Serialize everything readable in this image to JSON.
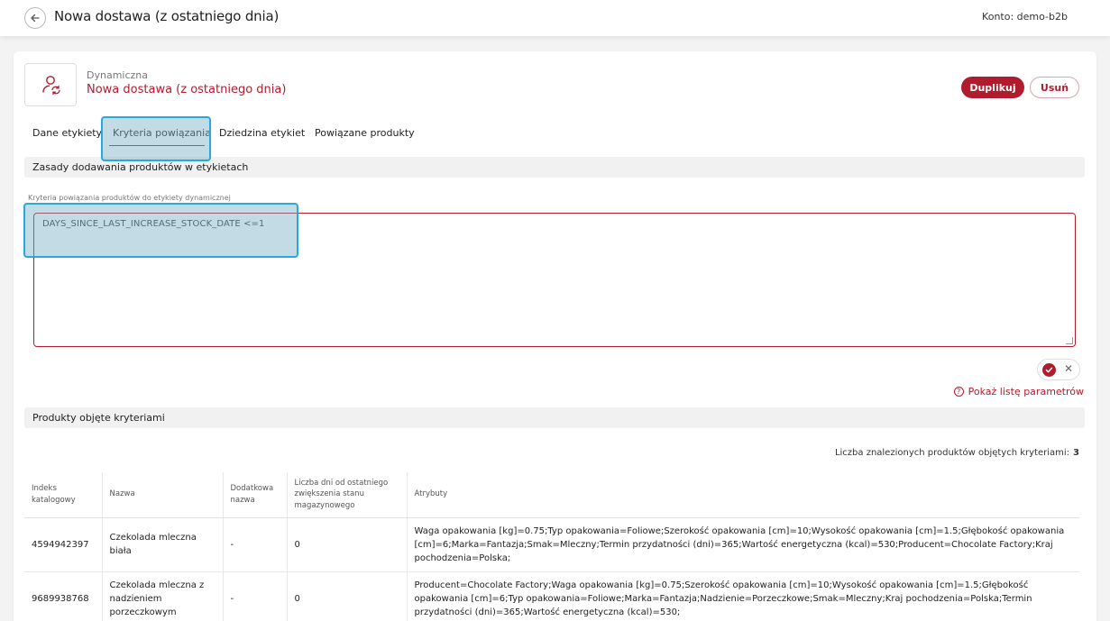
{
  "header": {
    "title": "Nowa dostawa (z ostatniego dnia)",
    "account": "Konto: demo-b2b"
  },
  "label": {
    "type": "Dynamiczna",
    "name": "Nowa dostawa (z ostatniego dnia)",
    "duplicate": "Duplikuj",
    "delete": "Usuń"
  },
  "tabs": [
    {
      "label": "Dane etykiety"
    },
    {
      "label": "Kryteria powiązania"
    },
    {
      "label": "Dziedzina etykiet"
    },
    {
      "label": "Powiązane produkty"
    }
  ],
  "rules": {
    "section_title": "Zasady dodawania produktów w etykietach",
    "field_label": "Kryteria powiązania produktów do etykiety dynamicznej",
    "criteria_value": "DAYS_SINCE_LAST_INCREASE_STOCK_DATE <=1",
    "show_params": "Pokaż listę parametrów"
  },
  "products": {
    "section_title": "Produkty objęte kryteriami",
    "count_label": "Liczba znalezionych produktów objętych kryteriami:",
    "count": "3",
    "columns": [
      "Indeks katalogowy",
      "Nazwa",
      "Dodatkowa nazwa",
      "Liczba dni od ostatniego zwiększenia stanu magazynowego",
      "Atrybuty"
    ],
    "rows": [
      {
        "index": "4594942397",
        "name": "Czekolada mleczna biała",
        "extra": "-",
        "days": "0",
        "attrs": "Waga opakowania [kg]=0.75;Typ opakowania=Foliowe;Szerokość opakowania [cm]=10;Wysokość opakowania [cm]=1.5;Głębokość opakowania [cm]=6;Marka=Fantazja;Smak=Mleczny;Termin przydatności (dni)=365;Wartość energetyczna (kcal)=530;Producent=Chocolate Factory;Kraj pochodzenia=Polska;"
      },
      {
        "index": "9689938768",
        "name": "Czekolada mleczna z nadzieniem porzeczkowym",
        "extra": "-",
        "days": "0",
        "attrs": "Producent=Chocolate Factory;Waga opakowania [kg]=0.75;Szerokość opakowania [cm]=10;Wysokość opakowania [cm]=1.5;Głębokość opakowania [cm]=6;Typ opakowania=Foliowe;Marka=Fantazja;Nadzienie=Porzeczkowe;Smak=Mleczny;Kraj pochodzenia=Polska;Termin przydatności (dni)=365;Wartość energetyczna (kcal)=530;"
      }
    ]
  },
  "colors": {
    "accent": "#b01c2e",
    "highlight": "#27a9e0"
  }
}
